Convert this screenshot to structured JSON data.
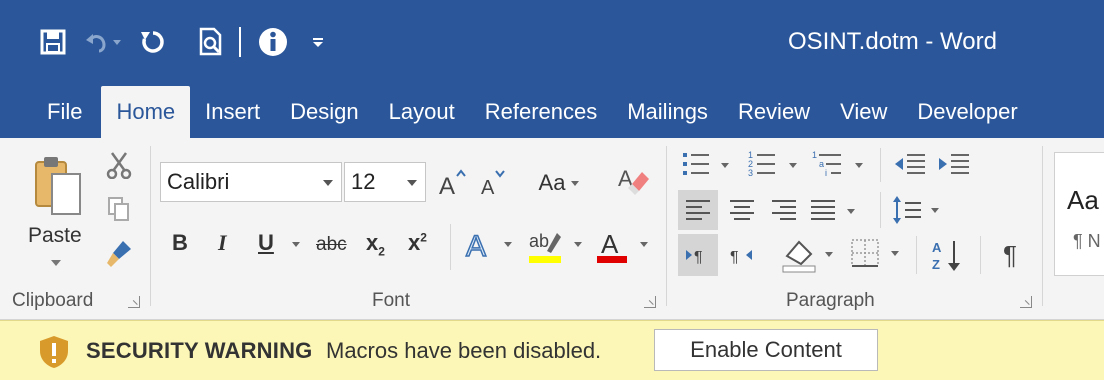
{
  "window": {
    "title": "OSINT.dotm - Word"
  },
  "qat": {
    "icons": [
      "save-icon",
      "undo-icon",
      "redo-icon",
      "print-preview-icon",
      "info-icon",
      "customize-qat-icon"
    ]
  },
  "tabs": [
    {
      "label": "File"
    },
    {
      "label": "Home",
      "active": true
    },
    {
      "label": "Insert"
    },
    {
      "label": "Design"
    },
    {
      "label": "Layout"
    },
    {
      "label": "References"
    },
    {
      "label": "Mailings"
    },
    {
      "label": "Review"
    },
    {
      "label": "View"
    },
    {
      "label": "Developer"
    }
  ],
  "ribbon": {
    "clipboard": {
      "label": "Clipboard",
      "paste_label": "Paste"
    },
    "font": {
      "label": "Font",
      "font_name": "Calibri",
      "font_size": "12",
      "change_case": "Aa",
      "bold": "B",
      "italic": "I",
      "underline": "U",
      "strikethrough": "abc",
      "subscript": "x",
      "superscript": "x",
      "highlight_color": "#ffff00",
      "font_color": "#e00000"
    },
    "paragraph": {
      "label": "Paragraph",
      "pilcrow": "¶"
    },
    "styles": {
      "preview": "Aa",
      "preview_sub": "¶ N"
    }
  },
  "message_bar": {
    "title": "SECURITY WARNING",
    "text": "Macros have been disabled.",
    "button": "Enable Content"
  },
  "colors": {
    "brand": "#2b579a",
    "ribbon_bg": "#f4f4f4",
    "warning_bg": "#fcf7b6"
  }
}
